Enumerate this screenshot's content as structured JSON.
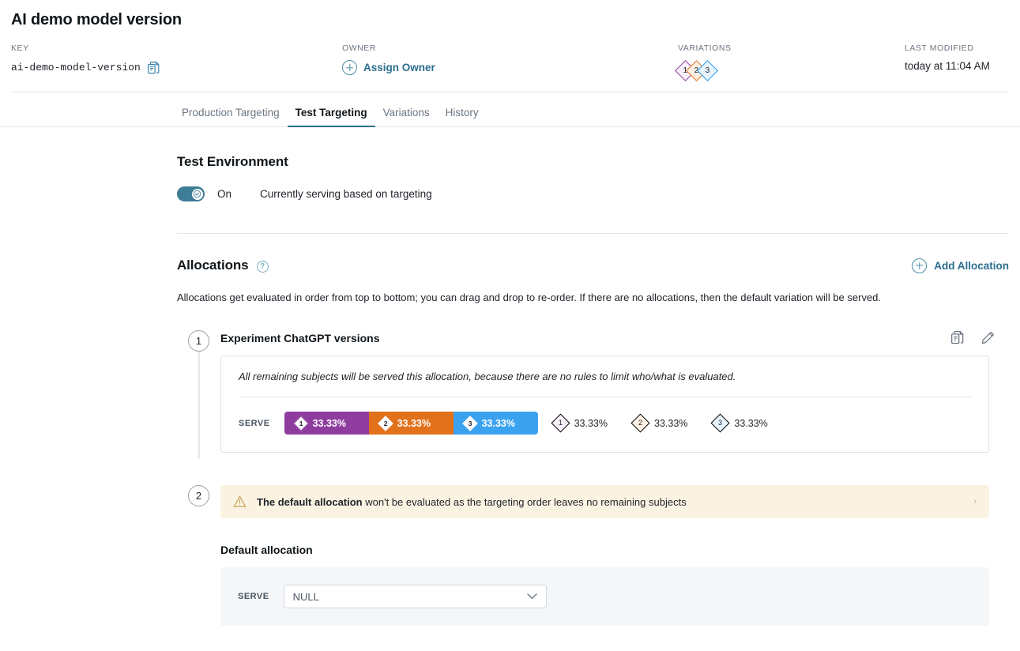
{
  "header": {
    "title": "AI demo model version",
    "key_label": "KEY",
    "key_value": "ai-demo-model-version",
    "copy_icon": "copy-icon",
    "owner_label": "OWNER",
    "assign_owner_label": "Assign Owner",
    "variations_label": "VARIATIONS",
    "variation_badges": [
      {
        "num": "1",
        "color": "#8e3d9e"
      },
      {
        "num": "2",
        "color": "#e2711c"
      },
      {
        "num": "3",
        "color": "#2196e8"
      }
    ],
    "last_modified_label": "LAST MODIFIED",
    "last_modified_value": "today at 11:04 AM"
  },
  "tabs": [
    {
      "label": "Production Targeting",
      "active": false
    },
    {
      "label": "Test Targeting",
      "active": true
    },
    {
      "label": "Variations",
      "active": false
    },
    {
      "label": "History",
      "active": false
    }
  ],
  "test_environment": {
    "title": "Test Environment",
    "toggle_state": "on",
    "toggle_label": "On",
    "description": "Currently serving based on targeting"
  },
  "allocations": {
    "title": "Allocations",
    "help_icon_glyph": "?",
    "add_label": "Add Allocation",
    "description": "Allocations get evaluated in order from top to bottom; you can drag and drop to re-order. If there are no allocations, then the default variation will be served.",
    "items": [
      {
        "step": "1",
        "title": "Experiment ChatGPT versions",
        "note": "All remaining subjects will be served this allocation, because there are no rules to limit who/what is evaluated.",
        "serve_label": "SERVE",
        "segments": [
          {
            "num": "1",
            "percent": "33.33%",
            "color": "#8e3d9e"
          },
          {
            "num": "2",
            "percent": "33.33%",
            "color": "#e2711c"
          },
          {
            "num": "3",
            "percent": "33.33%",
            "color": "#3ba2ef"
          }
        ],
        "legend": [
          {
            "num": "1",
            "percent": "33.33%",
            "color": "#8e3d9e"
          },
          {
            "num": "2",
            "percent": "33.33%",
            "color": "#e2711c"
          },
          {
            "num": "3",
            "percent": "33.33%",
            "color": "#2196e8"
          }
        ],
        "copy_icon": "copy-icon",
        "edit_icon": "pencil-icon"
      }
    ]
  },
  "default_allocation": {
    "step": "2",
    "warning_icon": "warning-triangle-icon",
    "warning_bold": "The default allocation",
    "warning_rest": " won't be evaluated as the targeting order leaves no remaining subjects",
    "warning_chevron": "›",
    "title": "Default allocation",
    "serve_label": "SERVE",
    "select_value": "NULL"
  }
}
